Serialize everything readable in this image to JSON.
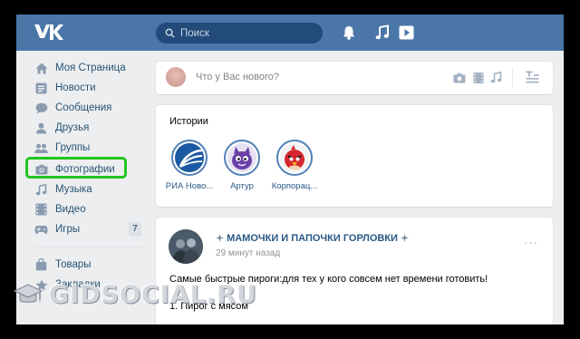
{
  "search": {
    "placeholder": "Поиск"
  },
  "icons": {
    "logo": "vk-logo-icon",
    "search": "search-icon",
    "bell": "bell-icon",
    "music": "music-note-icon",
    "play": "play-icon"
  },
  "sidebar": {
    "items": [
      {
        "label": "Моя Страница",
        "icon": "home-icon"
      },
      {
        "label": "Новости",
        "icon": "news-icon"
      },
      {
        "label": "Сообщения",
        "icon": "chat-icon"
      },
      {
        "label": "Друзья",
        "icon": "person-icon"
      },
      {
        "label": "Группы",
        "icon": "people-icon"
      },
      {
        "label": "Фотографии",
        "icon": "camera-icon"
      },
      {
        "label": "Музыка",
        "icon": "music-note-icon"
      },
      {
        "label": "Видео",
        "icon": "film-icon"
      },
      {
        "label": "Игры",
        "icon": "gamepad-icon",
        "badge": "7"
      },
      {
        "label": "Товары",
        "icon": "bag-icon"
      },
      {
        "label": "Закладки",
        "icon": "star-icon"
      }
    ]
  },
  "composer": {
    "placeholder": "Что у Вас нового?"
  },
  "stories": {
    "title": "Истории",
    "items": [
      {
        "name": "РИА Ново..."
      },
      {
        "name": "Артур"
      },
      {
        "name": "Корпорац..."
      }
    ]
  },
  "post": {
    "group": "МАМОЧКИ И ПАПОЧКИ ГОРЛОВКИ",
    "time": "29 минут назад",
    "text": "Самые быстрые пироги:для тех у кого совсем нет времени готовить!",
    "text2": "1. Пирог с мясом",
    "more": "···"
  },
  "watermark": {
    "text": "GIDSOCIAL.RU"
  },
  "colors": {
    "header": "#4a76a8",
    "link": "#2a5885",
    "highlight": "#21c51d",
    "background": "#edeef0"
  }
}
